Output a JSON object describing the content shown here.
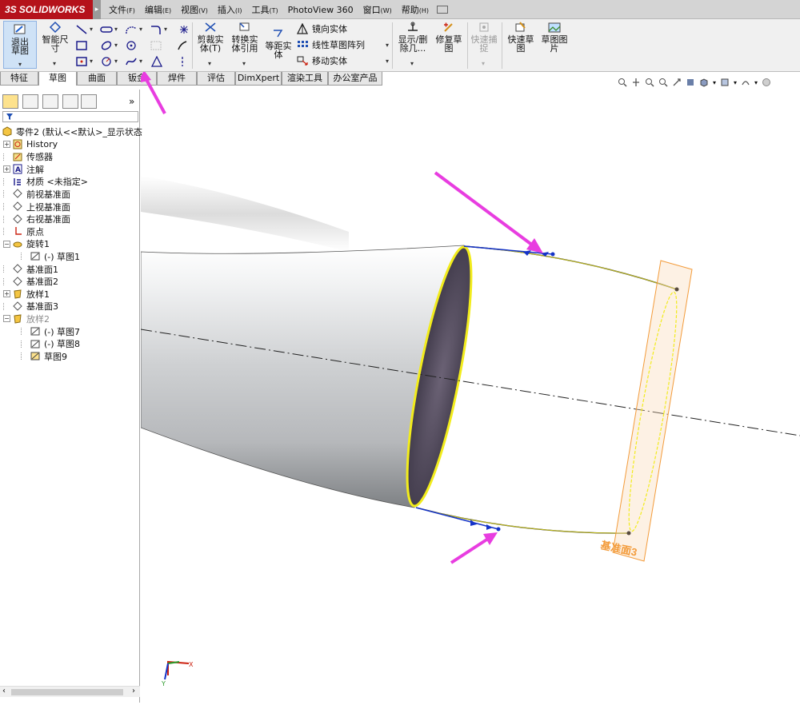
{
  "app": {
    "logo_ds": "3S",
    "logo_text": "SOLIDWORKS",
    "menu": [
      {
        "label": "文件",
        "key": "(F)"
      },
      {
        "label": "编辑",
        "key": "(E)"
      },
      {
        "label": "视图",
        "key": "(V)"
      },
      {
        "label": "插入",
        "key": "(I)"
      },
      {
        "label": "工具",
        "key": "(T)"
      },
      {
        "label": "PhotoView 360",
        "key": ""
      },
      {
        "label": "窗口",
        "key": "(W)"
      },
      {
        "label": "帮助",
        "key": "(H)"
      }
    ]
  },
  "toolbar": {
    "exit_sketch": "退出草图",
    "smart_dimension": "智能尺寸",
    "trim": "剪裁实体(T)",
    "convert": "转换实体引用",
    "offset": "等距实体",
    "mirror": "镜向实体",
    "linear_pattern": "线性草图阵列",
    "move": "移动实体",
    "display_delete": "显示/删除几...",
    "repair": "修复草图",
    "quick_snap": "快速捕捉",
    "rapid_sketch": "快速草图",
    "sketch_picture": "草图图片"
  },
  "tabs": [
    {
      "label": "特征",
      "active": false
    },
    {
      "label": "草图",
      "active": true
    },
    {
      "label": "曲面",
      "active": false
    },
    {
      "label": "钣金",
      "active": false
    },
    {
      "label": "焊件",
      "active": false
    },
    {
      "label": "评估",
      "active": false
    },
    {
      "label": "DimXpert",
      "active": false
    },
    {
      "label": "渲染工具",
      "active": false
    },
    {
      "label": "办公室产品",
      "active": false
    }
  ],
  "tree": {
    "root": "零件2 (默认<<默认>_显示状态",
    "items": [
      {
        "label": "History",
        "icon": "history-icon",
        "expander": "+"
      },
      {
        "label": "传感器",
        "icon": "sensor-icon",
        "expander": ""
      },
      {
        "label": "注解",
        "icon": "annotation-icon",
        "expander": "+"
      },
      {
        "label": "材质 <未指定>",
        "icon": "material-icon",
        "expander": ""
      },
      {
        "label": "前视基准面",
        "icon": "plane-icon",
        "expander": ""
      },
      {
        "label": "上视基准面",
        "icon": "plane-icon",
        "expander": ""
      },
      {
        "label": "右视基准面",
        "icon": "plane-icon",
        "expander": ""
      },
      {
        "label": "原点",
        "icon": "origin-icon",
        "expander": ""
      },
      {
        "label": "旋转1",
        "icon": "revolve-icon",
        "expander": "-"
      },
      {
        "label": "(-) 草图1",
        "icon": "sketch-icon",
        "expander": "",
        "indent": 1
      },
      {
        "label": "基准面1",
        "icon": "plane-icon",
        "expander": ""
      },
      {
        "label": "基准面2",
        "icon": "plane-icon",
        "expander": ""
      },
      {
        "label": "放样1",
        "icon": "loft-icon",
        "expander": "+"
      },
      {
        "label": "基准面3",
        "icon": "plane-icon",
        "expander": ""
      },
      {
        "label": "放样2",
        "icon": "loft-icon",
        "expander": "-",
        "grey": true
      },
      {
        "label": "(-) 草图7",
        "icon": "sketch-icon",
        "expander": "",
        "indent": 1
      },
      {
        "label": "(-) 草图8",
        "icon": "sketch-icon",
        "expander": "",
        "indent": 1
      },
      {
        "label": "草图9",
        "icon": "active-sketch-icon",
        "expander": "",
        "indent": 1
      }
    ]
  },
  "viewport": {
    "plane_label": "基准面3",
    "triad_x": "X",
    "triad_y": "Y"
  },
  "colors": {
    "logo_red": "#b5121b",
    "annotation_magenta": "#e83de0",
    "sketch_blue": "#1433c8",
    "edge_yellow": "#f2ec1c",
    "plane_orange": "#f39b3a"
  }
}
